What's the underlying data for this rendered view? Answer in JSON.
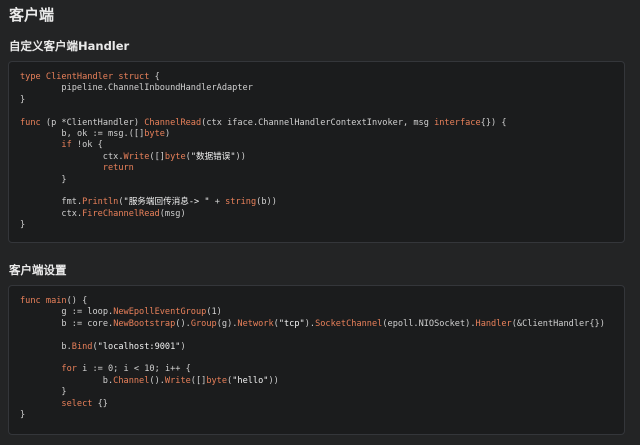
{
  "section_title": "客户端",
  "subsections": [
    {
      "title": "自定义客户端Handler",
      "code_lines": [
        "type ClientHandler struct {",
        "        pipeline.ChannelInboundHandlerAdapter",
        "}",
        "",
        "func (p *ClientHandler) ChannelRead(ctx iface.ChannelHandlerContextInvoker, msg interface{}) {",
        "        b, ok := msg.([]byte)",
        "        if !ok {",
        "                ctx.Write([]byte(\"数据错误\"))",
        "                return",
        "        }",
        "",
        "        fmt.Println(\"服务端回传消息-> \" + string(b))",
        "        ctx.FireChannelRead(msg)",
        "}"
      ]
    },
    {
      "title": "客户端设置",
      "code_lines": [
        "func main() {",
        "        g := loop.NewEpollEventGroup(1)",
        "        b := core.NewBootstrap().Group(g).Network(\"tcp\").SocketChannel(epoll.NIOSocket).Handler(&ClientHandler{})",
        "",
        "        b.Bind(\"localhost:9001\")",
        "",
        "        for i := 0; i < 10; i++ {",
        "                b.Channel().Write([]byte(\"hello\"))",
        "        }",
        "        select {}",
        "}"
      ]
    }
  ],
  "colors": {
    "background": "#232425",
    "code_background": "#1b1c1d",
    "keyword": "#e8805a",
    "text": "#d0d0d0"
  }
}
